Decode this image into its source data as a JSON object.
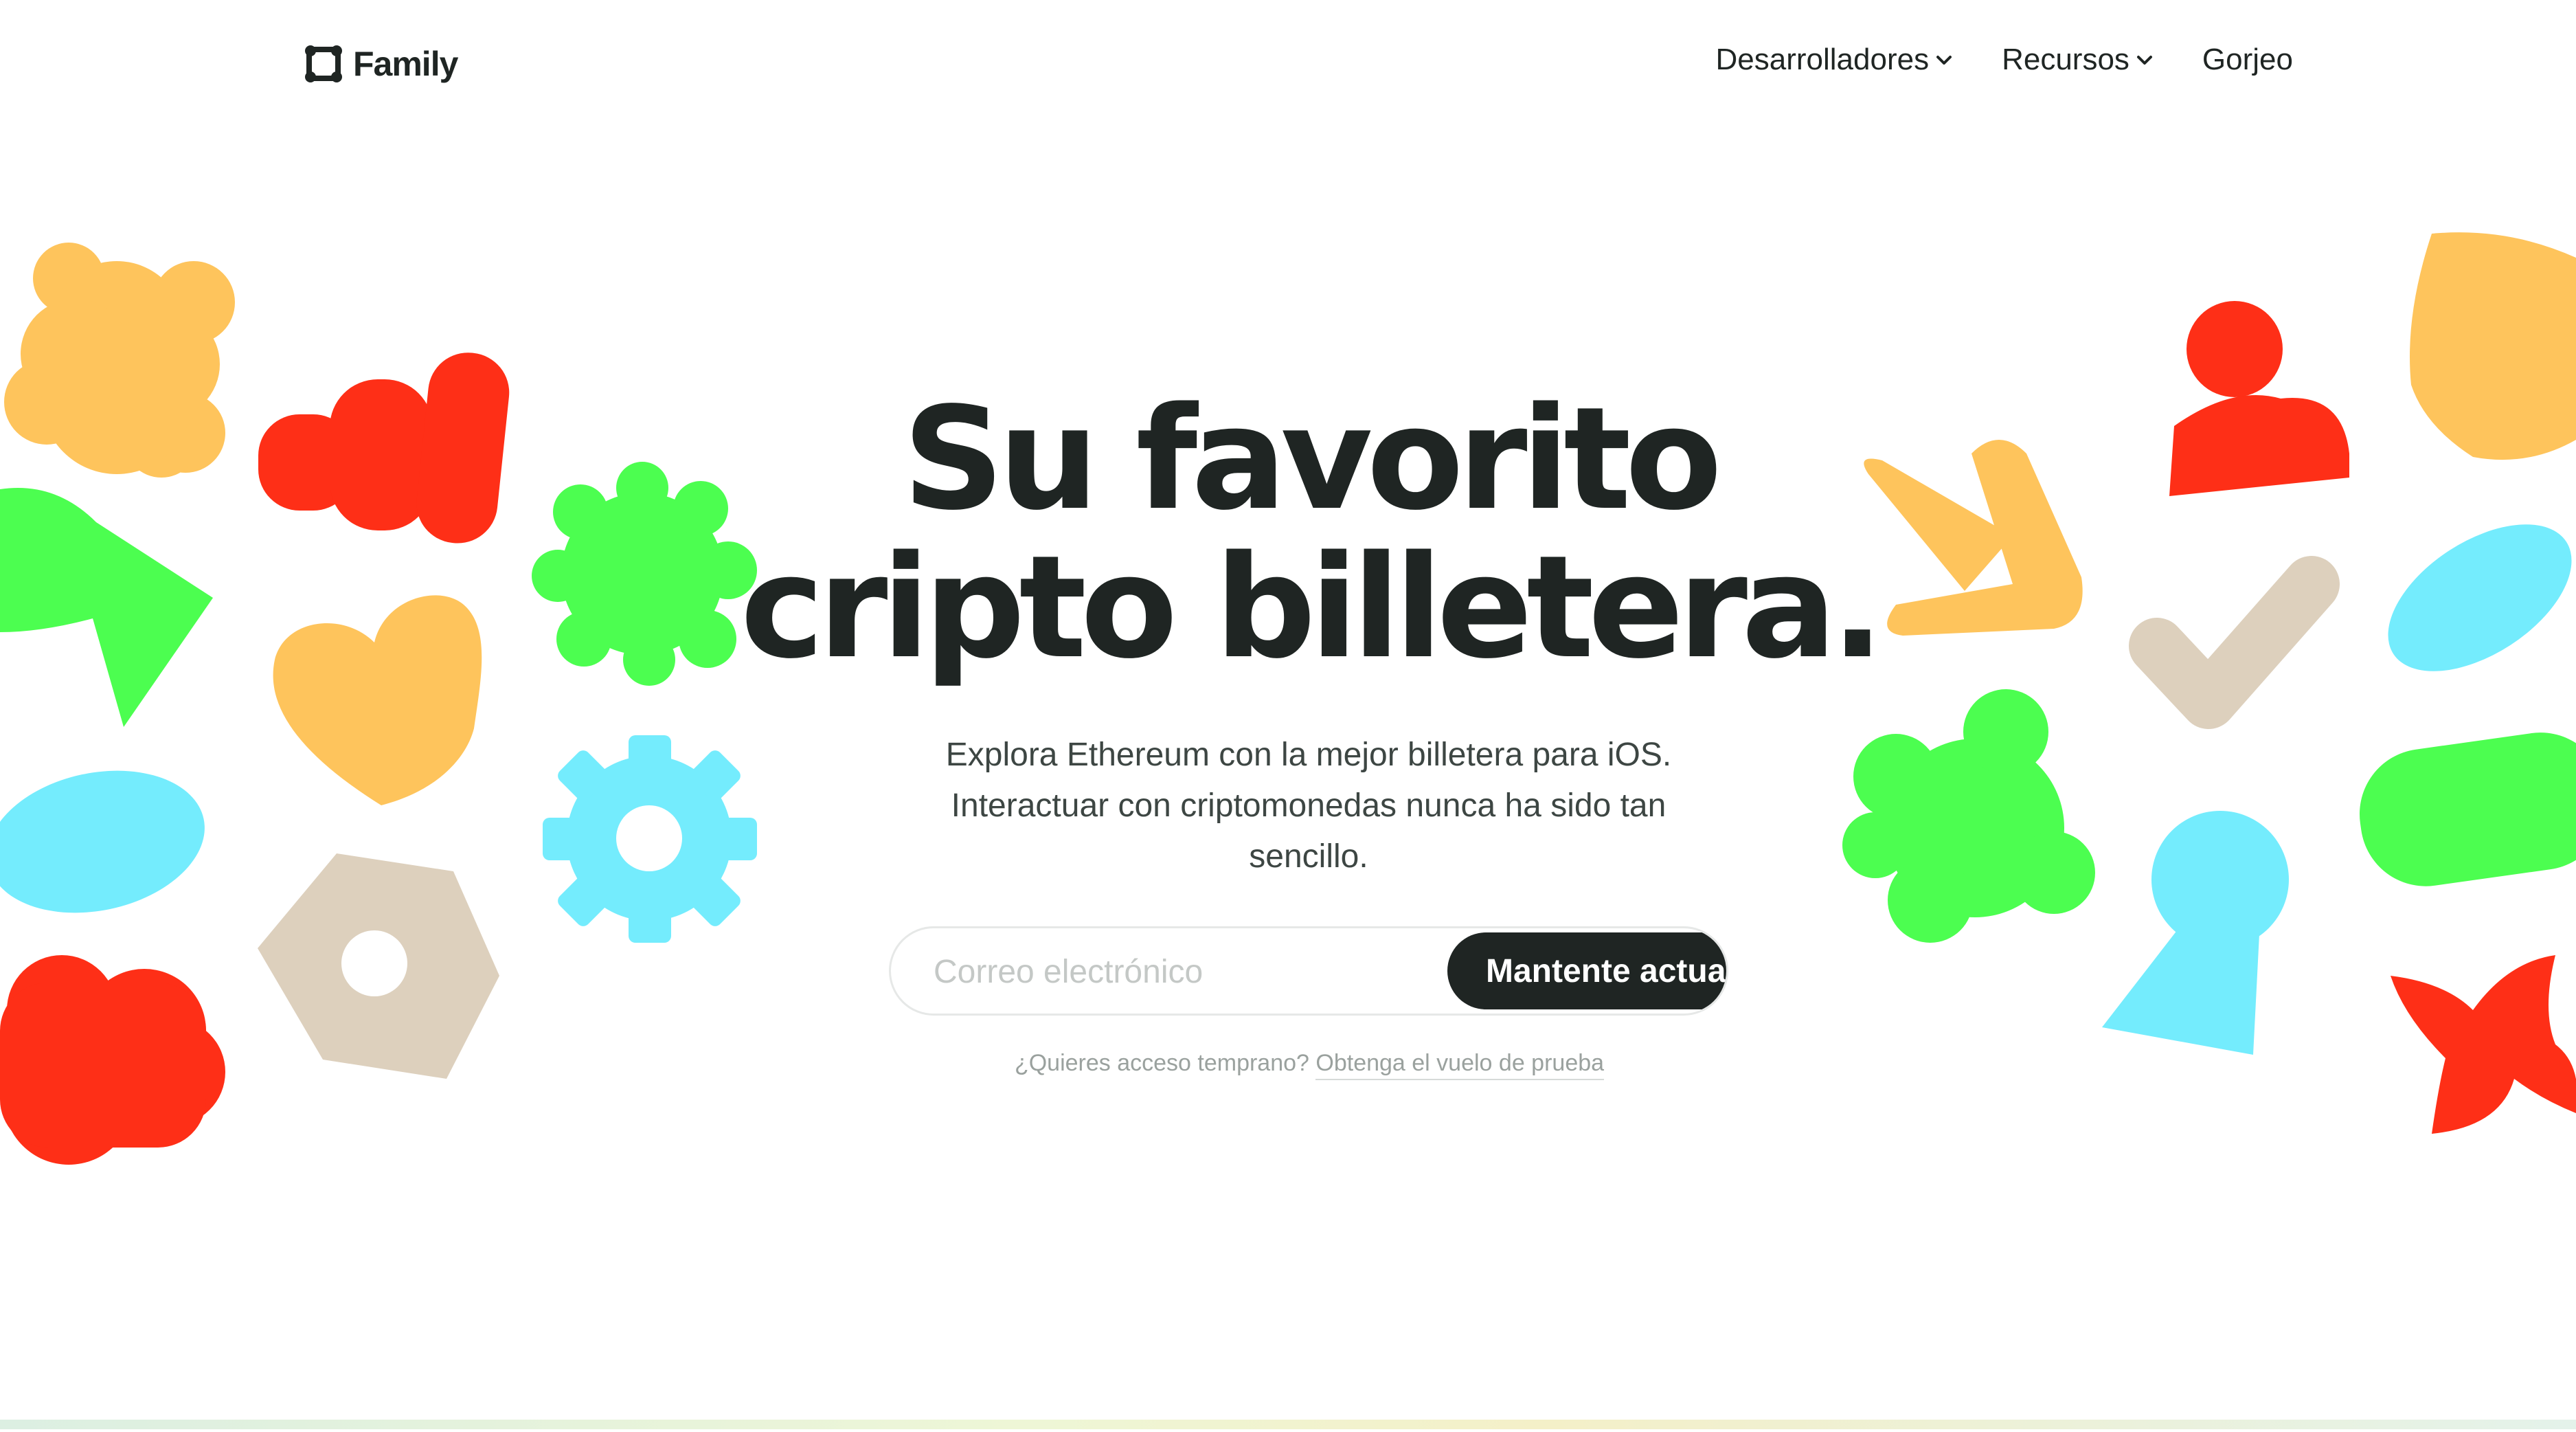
{
  "header": {
    "brand": "Family",
    "logo_icon": "family-frame-icon",
    "nav": [
      {
        "label": "Desarrolladores",
        "icon": "chevron-down-icon"
      },
      {
        "label": "Recursos",
        "icon": "chevron-down-icon"
      },
      {
        "label": "Gorjeo"
      }
    ]
  },
  "hero": {
    "title_line1": "Su favorito",
    "title_line2": "cripto billetera.",
    "subtitle": "Explora Ethereum con la mejor billetera para iOS. Interactuar con criptomonedas nunca ha sido tan sencillo.",
    "email_placeholder": "Correo electrónico",
    "cta_label": "Mantente actualizado",
    "early_access_prefix": "¿Quieres acceso temprano?",
    "early_access_link": "Obtenga el vuelo de prueba"
  },
  "colors": {
    "text": "#1f2523",
    "orange": "#fec45c",
    "red": "#fe2f17",
    "green": "#4cfe50",
    "blue": "#74ecfd",
    "beige": "#ddd0bd"
  },
  "decorations": [
    "flower-shape",
    "wavy-bars-shape",
    "bowtie-shape",
    "heart-shape",
    "scalloped-flower-shape",
    "oval-shape",
    "gear-shape",
    "cloud-shape",
    "hex-nut-shape",
    "arrow-shape",
    "person-shape",
    "shield-shape",
    "checkmark-shape",
    "leaf-oval-shape",
    "blob-flower-shape",
    "keyhole-shape",
    "pill-shape",
    "cross-star-shape"
  ]
}
